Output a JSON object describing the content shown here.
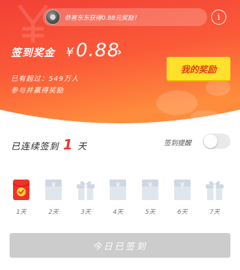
{
  "colors": {
    "hero_top": "#f5433a",
    "hero_bottom": "#ff8a3a",
    "accent_red": "#f5352d",
    "button_yellow": "#ffe02a",
    "disabled_gray": "#cccccc"
  },
  "notice": {
    "text": "恭喜东东获得0.88元奖励！",
    "avatar_icon": "user-avatar"
  },
  "info_icon": "i",
  "reward": {
    "label": "签到奖金",
    "currency": "¥",
    "amount": "0.88",
    "arrow": "›"
  },
  "stats": {
    "line1": "已有超过：549万人",
    "line2": "参与并赢得奖励"
  },
  "my_reward_button": "我的奖励",
  "streak": {
    "prefix": "已连续签到",
    "days": "1",
    "suffix": "天"
  },
  "remind": {
    "label": "签到提醒",
    "enabled": false
  },
  "days": [
    {
      "label": "1天",
      "kind": "checked"
    },
    {
      "label": "2天",
      "kind": "envelope"
    },
    {
      "label": "3天",
      "kind": "gift"
    },
    {
      "label": "4天",
      "kind": "envelope"
    },
    {
      "label": "5天",
      "kind": "envelope"
    },
    {
      "label": "6天",
      "kind": "envelope"
    },
    {
      "label": "7天",
      "kind": "gift"
    }
  ],
  "sign_button": "今日已签到"
}
